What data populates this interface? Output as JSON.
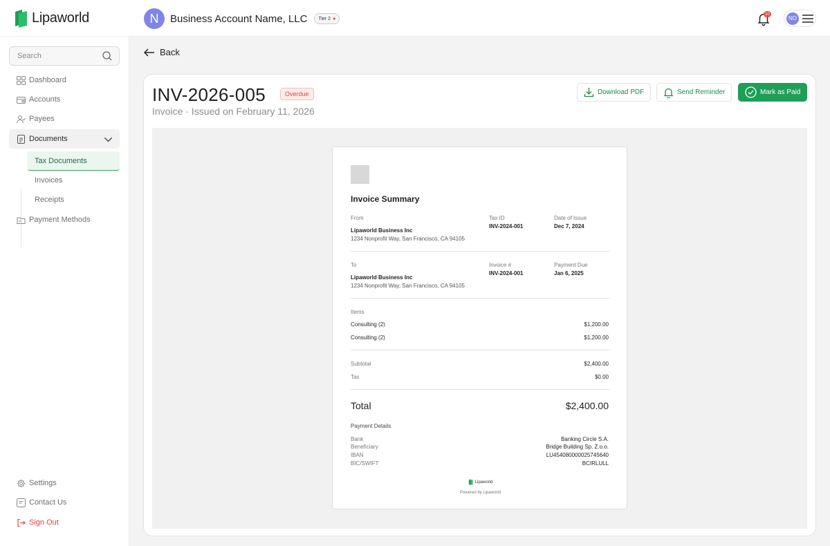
{
  "app": {
    "name": "Lipaworld",
    "brand_color": "#1e9e57"
  },
  "header": {
    "account_initial": "N",
    "account_name": "Business Account Name, LLC",
    "tier_label": "Tier 2",
    "notification_count": "10",
    "user_initials": "NO"
  },
  "sidebar": {
    "search_placeholder": "Search",
    "items": [
      {
        "label": "Dashboard",
        "icon": "grid-icon"
      },
      {
        "label": "Accounts",
        "icon": "wallet-icon"
      },
      {
        "label": "Payees",
        "icon": "users-icon"
      },
      {
        "label": "Documents",
        "icon": "document-icon",
        "expanded": true
      },
      {
        "label": "Payment Methods",
        "icon": "card-icon"
      }
    ],
    "subitems": [
      {
        "label": "Tax Documents",
        "active": true
      },
      {
        "label": "Invoices"
      },
      {
        "label": "Receipts"
      }
    ],
    "footer": [
      {
        "label": "Settings",
        "icon": "gear-icon"
      },
      {
        "label": "Contact Us",
        "icon": "chat-icon"
      },
      {
        "label": "Sign Out",
        "icon": "sign-out-icon"
      }
    ]
  },
  "page": {
    "back_label": "Back",
    "invoice_number": "INV-2026-005",
    "status": "Overdue",
    "subtitle": "Invoice · Issued on February 11, 2026",
    "actions": {
      "download": "Download PDF",
      "reminder": "Send Reminder",
      "mark_paid": "Mark as Paid"
    }
  },
  "document": {
    "title": "Invoice Summary",
    "from": {
      "label": "From",
      "name": "Lipaworld Business Inc",
      "address": "1234 Nonprofit Way, San Francisco, CA 94105",
      "tax_id_label": "Tax ID",
      "tax_id": "INV-2024-001",
      "issue_label": "Date of Issue",
      "issue_date": "Dec 7, 2024"
    },
    "to": {
      "label": "To",
      "name": "Lipaworld Business Inc",
      "address": "1234 Nonprofit Way, San Francisco, CA 94105",
      "invoice_label": "Invoice #",
      "invoice_no": "INV-2024-001",
      "due_label": "Payment Due",
      "due_date": "Jan 6, 2025"
    },
    "items_label": "Items",
    "items": [
      {
        "desc": "Consulting (2)",
        "amount": "$1,200.00"
      },
      {
        "desc": "Consulting (2)",
        "amount": "$1,200.00"
      }
    ],
    "subtotal_label": "Subtotal",
    "subtotal": "$2,400.00",
    "tax_label": "Tax",
    "tax": "$0.00",
    "total_label": "Total",
    "total": "$2,400.00",
    "payment_details_label": "Payment Details",
    "payment": [
      {
        "label": "Bank",
        "value": "Banking Circle S.A."
      },
      {
        "label": "Beneficiary",
        "value": "Bridge Building Sp. Z.o.o."
      },
      {
        "label": "IBAN",
        "value": "LU454080000025745640"
      },
      {
        "label": "BIC/SWIFT",
        "value": "BCIRLULL"
      }
    ],
    "footer_brand": "Lipaworld",
    "footer_powered": "Powered by Lipaworld"
  }
}
